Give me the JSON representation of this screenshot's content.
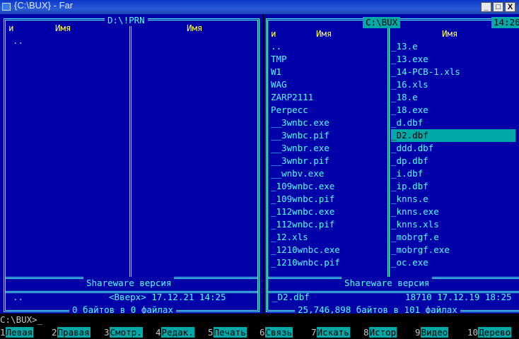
{
  "window": {
    "title": "{C:\\BUX} - Far",
    "minimize": "_",
    "maximize": "□",
    "close": "X"
  },
  "left_panel": {
    "path": "D:\\!PRN",
    "col_markers": [
      "и"
    ],
    "col_headers": [
      "Имя",
      "Имя"
    ],
    "files": [
      ".."
    ],
    "shareware": "Shareware версия",
    "info_name": "..",
    "info_detail": "<Вверх> 17.12.21 14:25",
    "summary": "0 байтов в 0 файлах"
  },
  "right_panel": {
    "path": "C:\\BUX",
    "clock": "14:26",
    "col_marker": "и",
    "col_headers": [
      "Имя",
      "Имя"
    ],
    "files_col1": [
      "..",
      "TMP",
      "W1",
      "WAG",
      "ZARP2111",
      "Perpecc",
      "__3wnbc.exe",
      "__3wnbc.pif",
      "__3wnbr.exe",
      "__3wnbr.pif",
      "__wnbv.exe",
      "_109wnbc.exe",
      "_109wnbc.pif",
      "_112wnbc.exe",
      "_112wnbc.pif",
      "_12.xls",
      "_1210wnbc.exe",
      "_1210wnbc.pif"
    ],
    "files_col2": [
      "_13.e",
      "_13.exe",
      "_14-PCB-1.xls",
      "_16.xls",
      "_18.e",
      "_18.exe",
      "_d.dbf",
      "_D2.dbf",
      "_ddd.dbf",
      "_dp.dbf",
      "_i.dbf",
      "_ip.dbf",
      "_knns.e",
      "_knns.exe",
      "_knns.xls",
      "_mobrgf.e",
      "_mobrgf.exe",
      "_oc.exe"
    ],
    "selected_index_col2": 7,
    "shareware": "Shareware версия",
    "info_name": "_D2.dbf",
    "info_detail": "18710 17.12.19 18:25",
    "summary": "25,746,898 байтов в 101 файлах"
  },
  "command_line": {
    "prompt": "C:\\BUX>_"
  },
  "keybar": [
    {
      "num": "1",
      "label": "Левая"
    },
    {
      "num": "2",
      "label": "Правая"
    },
    {
      "num": "3",
      "label": "Смотр."
    },
    {
      "num": "4",
      "label": "Редак."
    },
    {
      "num": "5",
      "label": "Печать"
    },
    {
      "num": "6",
      "label": "Связь"
    },
    {
      "num": "7",
      "label": "Искать"
    },
    {
      "num": "8",
      "label": "Истор"
    },
    {
      "num": "9",
      "label": "Видео"
    },
    {
      "num": "10",
      "label": "Дерево"
    }
  ],
  "colors": {
    "panel_bg": "#0000a8",
    "frame": "#55ffff",
    "header": "#ffff55",
    "selection": "#00a8a8"
  }
}
